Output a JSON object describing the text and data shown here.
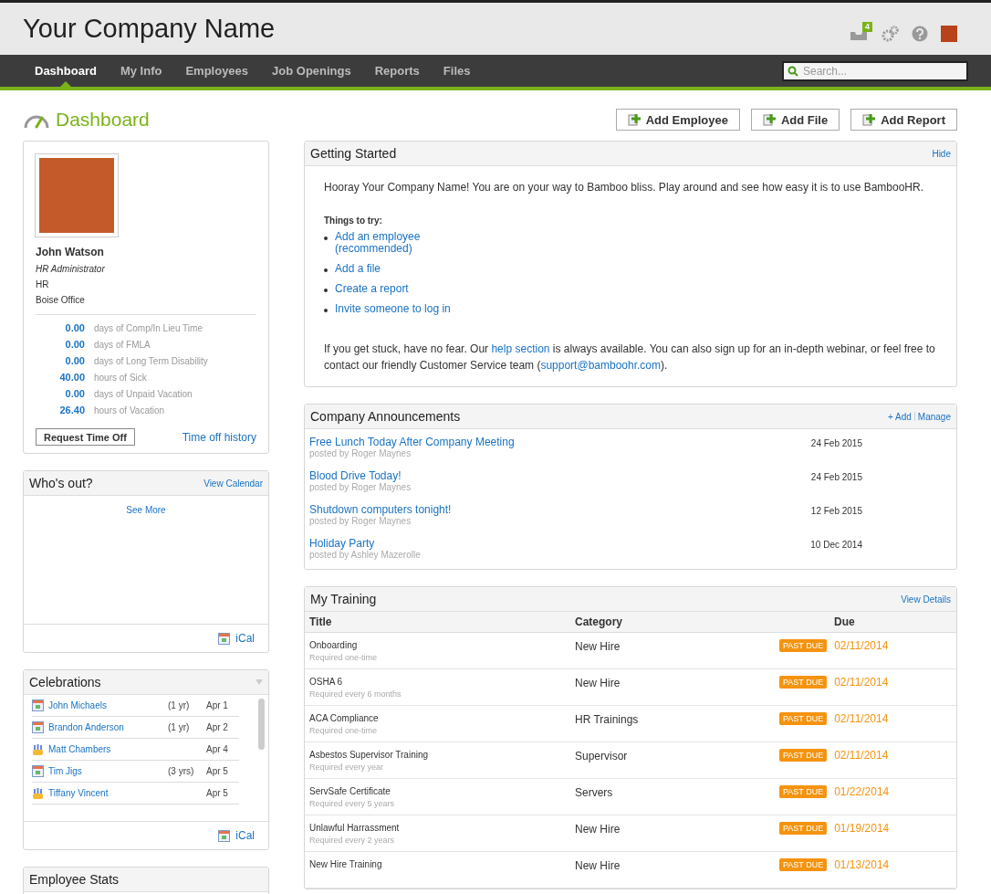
{
  "header": {
    "company": "Your Company Name",
    "inbox_count": "4"
  },
  "nav": {
    "tabs": [
      {
        "label": "Dashboard",
        "selected": true
      },
      {
        "label": "My Info",
        "selected": false
      },
      {
        "label": "Employees",
        "selected": false
      },
      {
        "label": "Job Openings",
        "selected": false
      },
      {
        "label": "Reports",
        "selected": false
      },
      {
        "label": "Files",
        "selected": false
      }
    ],
    "search": {
      "placeholder": "Search..."
    }
  },
  "page": {
    "title": "Dashboard",
    "actions": [
      "Add Employee",
      "Add File",
      "Add Report"
    ]
  },
  "profile": {
    "name": "John Watson",
    "job_title": "HR Administrator",
    "department": "HR",
    "location": "Boise Office",
    "balances": [
      {
        "amount": "0.00",
        "label": "days of Comp/In Lieu Time"
      },
      {
        "amount": "0.00",
        "label": "days of FMLA"
      },
      {
        "amount": "0.00",
        "label": "days of Long Term Disability"
      },
      {
        "amount": "40.00",
        "label": "hours of Sick"
      },
      {
        "amount": "0.00",
        "label": "days of Unpaid Vacation"
      },
      {
        "amount": "26.40",
        "label": "hours of Vacation"
      }
    ],
    "request_button": "Request Time Off",
    "history_link": "Time off history"
  },
  "whos_out": {
    "title": "Who's out?",
    "link": "View Calendar",
    "see_more": "See More",
    "ical": "iCal"
  },
  "celebrations": {
    "title": "Celebrations",
    "ical": "iCal",
    "items": [
      {
        "kind": "anniversary",
        "name": "John Michaels",
        "years": "(1 yr)",
        "date": "Apr 1"
      },
      {
        "kind": "anniversary",
        "name": "Brandon Anderson",
        "years": "(1 yr)",
        "date": "Apr 2"
      },
      {
        "kind": "birthday",
        "name": "Matt Chambers",
        "date": "Apr 4"
      },
      {
        "kind": "anniversary",
        "name": "Tim Jigs",
        "years": "(3 yrs)",
        "date": "Apr 5"
      },
      {
        "kind": "birthday",
        "name": "Tiffany Vincent",
        "date": "Apr 5"
      }
    ]
  },
  "employee_stats": {
    "title": "Employee Stats"
  },
  "getting_started": {
    "title": "Getting Started",
    "hide": "Hide",
    "intro": "Hooray Your Company Name! You are on your way to Bamboo bliss. Play around and see how easy it is to use BambooHR.",
    "things_heading": "Things to try:",
    "things": [
      "Add an employee\n(recommended)",
      "Add a file",
      "Create a report",
      "Invite someone to log in"
    ],
    "outro_parts": [
      {
        "kind": "text",
        "text": "If you get stuck, have no fear. Our "
      },
      {
        "kind": "link",
        "text": "help section"
      },
      {
        "kind": "text",
        "text": " is always available. You can also sign up for an in-depth webinar, or feel free to contact our friendly Customer Service team ("
      },
      {
        "kind": "link",
        "text": "support@bamboohr.com"
      },
      {
        "kind": "text",
        "text": ")."
      }
    ]
  },
  "announcements": {
    "title": "Company Announcements",
    "add": "+ Add",
    "manage": "Manage",
    "items": [
      {
        "title": "Free Lunch Today After Company Meeting",
        "byline": "posted by Roger Maynes",
        "date": "24 Feb 2015"
      },
      {
        "title": "Blood Drive Today!",
        "byline": "posted by Roger Maynes",
        "date": "24 Feb 2015"
      },
      {
        "title": "Shutdown computers tonight!",
        "byline": "posted by Roger Maynes",
        "date": "12 Feb 2015"
      },
      {
        "title": "Holiday Party",
        "byline": "posted by Ashley Mazerolle",
        "date": "10 Dec 2014"
      }
    ]
  },
  "training": {
    "title": "My Training",
    "link": "View Details",
    "columns": [
      "Title",
      "Category",
      "Due"
    ],
    "rows": [
      {
        "title": "Onboarding",
        "requirement": "Required one-time",
        "category": "New Hire",
        "past_due": true,
        "badge": "PAST DUE",
        "due": "02/11/2014"
      },
      {
        "title": "OSHA 6",
        "requirement": "Required every 6 months",
        "category": "New Hire",
        "past_due": true,
        "badge": "PAST DUE",
        "due": "02/11/2014"
      },
      {
        "title": "ACA Compliance",
        "requirement": "Required one-time",
        "category": "HR Trainings",
        "past_due": true,
        "badge": "PAST DUE",
        "due": "02/11/2014"
      },
      {
        "title": "Asbestos Supervisor Training",
        "requirement": "Required every year",
        "category": "Supervisor",
        "past_due": true,
        "badge": "PAST DUE",
        "due": "02/11/2014"
      },
      {
        "title": "ServSafe Certificate",
        "requirement": "Required every 5 years",
        "category": "Servers",
        "past_due": true,
        "badge": "PAST DUE",
        "due": "01/22/2014"
      },
      {
        "title": "Unlawful Harrassment",
        "requirement": "Required every 2 years",
        "category": "New Hire",
        "past_due": true,
        "badge": "PAST DUE",
        "due": "01/19/2014"
      },
      {
        "title": "New Hire Training",
        "category": "New Hire",
        "past_due": true,
        "badge": "PAST DUE",
        "due": "01/13/2014"
      }
    ]
  }
}
